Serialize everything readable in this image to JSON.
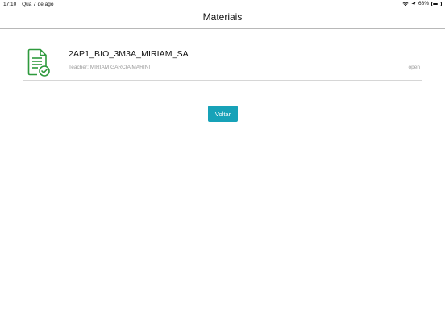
{
  "status_bar": {
    "time": "17:10",
    "date": "Qua 7 de ago",
    "battery_percent": "68%",
    "battery_level": 0.68
  },
  "nav": {
    "title": "Materiais"
  },
  "materials": [
    {
      "title": "2AP1_BIO_3M3A_MIRIAM_SA",
      "teacher": "Teacher: MIRIAM GARCIA MARINI",
      "status": "open",
      "icon": "document-check-icon"
    }
  ],
  "actions": {
    "back_label": "Voltar"
  },
  "colors": {
    "icon_green": "#2e9a3d",
    "button_teal": "#17a2b8"
  }
}
